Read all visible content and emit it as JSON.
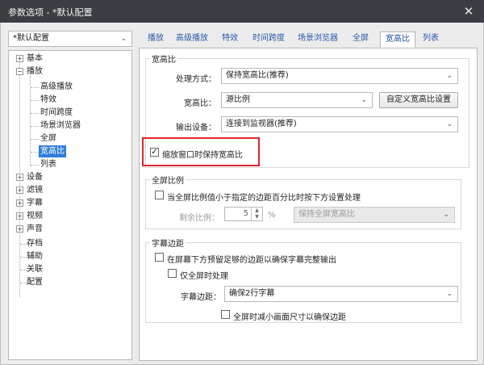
{
  "window": {
    "title": "参数选项 - *默认配置"
  },
  "profile": {
    "selected": "*默认配置"
  },
  "tree": {
    "items": [
      {
        "label": "基本"
      },
      {
        "label": "播放"
      },
      {
        "label": "高级播放"
      },
      {
        "label": "特效"
      },
      {
        "label": "时间跨度"
      },
      {
        "label": "场景浏览器"
      },
      {
        "label": "全屏"
      },
      {
        "label": "宽高比"
      },
      {
        "label": "列表"
      },
      {
        "label": "设备"
      },
      {
        "label": "滤镜"
      },
      {
        "label": "字幕"
      },
      {
        "label": "视频"
      },
      {
        "label": "声音"
      },
      {
        "label": "存档"
      },
      {
        "label": "辅助"
      },
      {
        "label": "关联"
      },
      {
        "label": "配置"
      }
    ]
  },
  "tabs": [
    "播放",
    "高级播放",
    "特效",
    "时间跨度",
    "场景浏览器",
    "全屏",
    "宽高比",
    "列表"
  ],
  "aspect": {
    "section_title": "宽高比",
    "method_label": "处理方式：",
    "method_value": "保持宽高比(推荐)",
    "ratio_label": "宽高比：",
    "ratio_value": "源比例",
    "custom_button": "自定义宽高比设置",
    "output_label": "输出设备：",
    "output_value": "连接到监视器(推荐)",
    "keep_on_resize": "缩放窗口时保持宽高比"
  },
  "fullscreen_ratio": {
    "section_title": "全屏比例",
    "checkbox_label": "当全屏比例值小于指定的边距百分比时按下方设置处理",
    "remaining_label": "剩余比例：",
    "remaining_value": "5",
    "unit": "%",
    "mode_value": "保持全屏宽高比"
  },
  "subtitle_margin": {
    "section_title": "字幕边距",
    "checkbox1": "在屏幕下方预留足够的边距以确保字幕完整输出",
    "checkbox2": "仅全屏时处理",
    "margin_label": "字幕边距：",
    "margin_value": "确保2行字幕",
    "checkbox3": "全屏时减小画面尺寸以确保边距"
  },
  "glyphs": {
    "close": "✕",
    "dropdown": "⌄",
    "check": "✓",
    "spin_up": "▲",
    "spin_down": "▼",
    "expand": "+",
    "collapse": "−"
  }
}
